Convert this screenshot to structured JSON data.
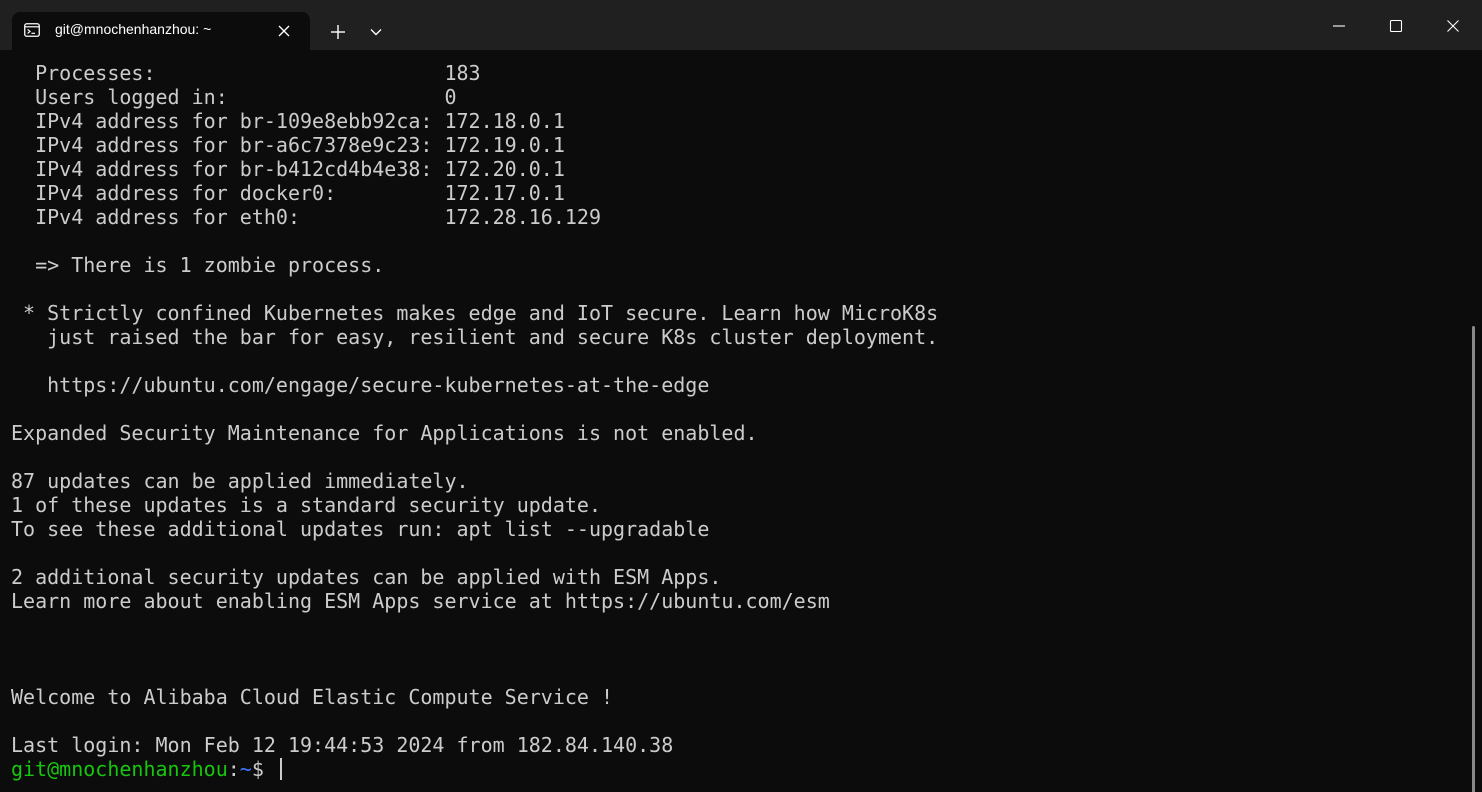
{
  "window": {
    "tab_title": "git@mnochenhanzhou: ~",
    "tab_icon": "terminal-icon",
    "close_tab_icon": "close-icon",
    "new_tab_icon": "plus-icon",
    "dropdown_icon": "chevron-down-icon",
    "minimize_icon": "minimize-icon",
    "maximize_icon": "maximize-icon",
    "close_window_icon": "close-icon"
  },
  "colors": {
    "background": "#0c0c0c",
    "titlebar": "#202020",
    "text": "#cccccc",
    "prompt_user": "#16c60c",
    "prompt_path": "#3b78ff"
  },
  "terminal": {
    "lines": [
      "  Processes:                        183",
      "  Users logged in:                  0",
      "  IPv4 address for br-109e8ebb92ca: 172.18.0.1",
      "  IPv4 address for br-a6c7378e9c23: 172.19.0.1",
      "  IPv4 address for br-b412cd4b4e38: 172.20.0.1",
      "  IPv4 address for docker0:         172.17.0.1",
      "  IPv4 address for eth0:            172.28.16.129",
      "",
      "  => There is 1 zombie process.",
      "",
      " * Strictly confined Kubernetes makes edge and IoT secure. Learn how MicroK8s",
      "   just raised the bar for easy, resilient and secure K8s cluster deployment.",
      "",
      "   https://ubuntu.com/engage/secure-kubernetes-at-the-edge",
      "",
      "Expanded Security Maintenance for Applications is not enabled.",
      "",
      "87 updates can be applied immediately.",
      "1 of these updates is a standard security update.",
      "To see these additional updates run: apt list --upgradable",
      "",
      "2 additional security updates can be applied with ESM Apps.",
      "Learn more about enabling ESM Apps service at https://ubuntu.com/esm",
      "",
      "",
      "",
      "Welcome to Alibaba Cloud Elastic Compute Service !",
      "",
      "Last login: Mon Feb 12 19:44:53 2024 from 182.84.140.38"
    ],
    "prompt": {
      "user_host": "git@mnochenhanzhou",
      "colon": ":",
      "path": "~",
      "symbol": "$ "
    }
  }
}
